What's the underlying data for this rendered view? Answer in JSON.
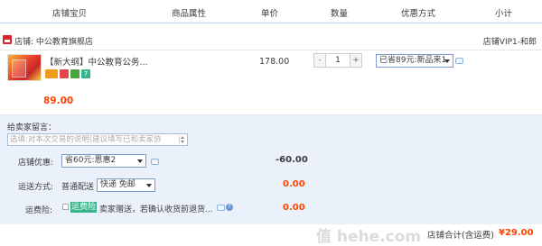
{
  "columns": [
    "店铺宝贝",
    "商品属性",
    "单价",
    "数量",
    "优惠方式",
    "小计"
  ],
  "shop": {
    "label": "店铺: 中公教育旗舰店",
    "wangwang": "店铺VIP1-和郎"
  },
  "item": {
    "title": "【新大纲】中公教育公务...",
    "badge_text": "7",
    "unit_price": "178.00",
    "quantity": "1",
    "qty_minus": "-",
    "qty_plus": "+",
    "promo_select": "已省89元:新品来1",
    "subtotal": "89.00"
  },
  "memo": {
    "label": "给卖家留言：",
    "placeholder": "选填:对本次交易的说明(建议填写已和卖家协"
  },
  "shop_discount": {
    "label": "店铺优惠:",
    "select": "省60元:恩惠2",
    "amount": "-60.00"
  },
  "shipping": {
    "label": "运送方式:",
    "method": "普通配送",
    "select": "快递 免邮",
    "amount": "0.00"
  },
  "insurance": {
    "label": "运费险:",
    "tag": "运费险",
    "text": "卖家赠送，若确认收货前退货...",
    "amount": "0.00",
    "help": "?"
  },
  "total": {
    "label": "店铺合计(含运费)",
    "amount": "¥29.00"
  },
  "watermark": "值 hehe.com",
  "colors": {
    "accent_red": "#ff4400",
    "panel_bg": "#eaf1fb",
    "header_line": "#b2d1ff",
    "green_tag": "#35b58b"
  }
}
